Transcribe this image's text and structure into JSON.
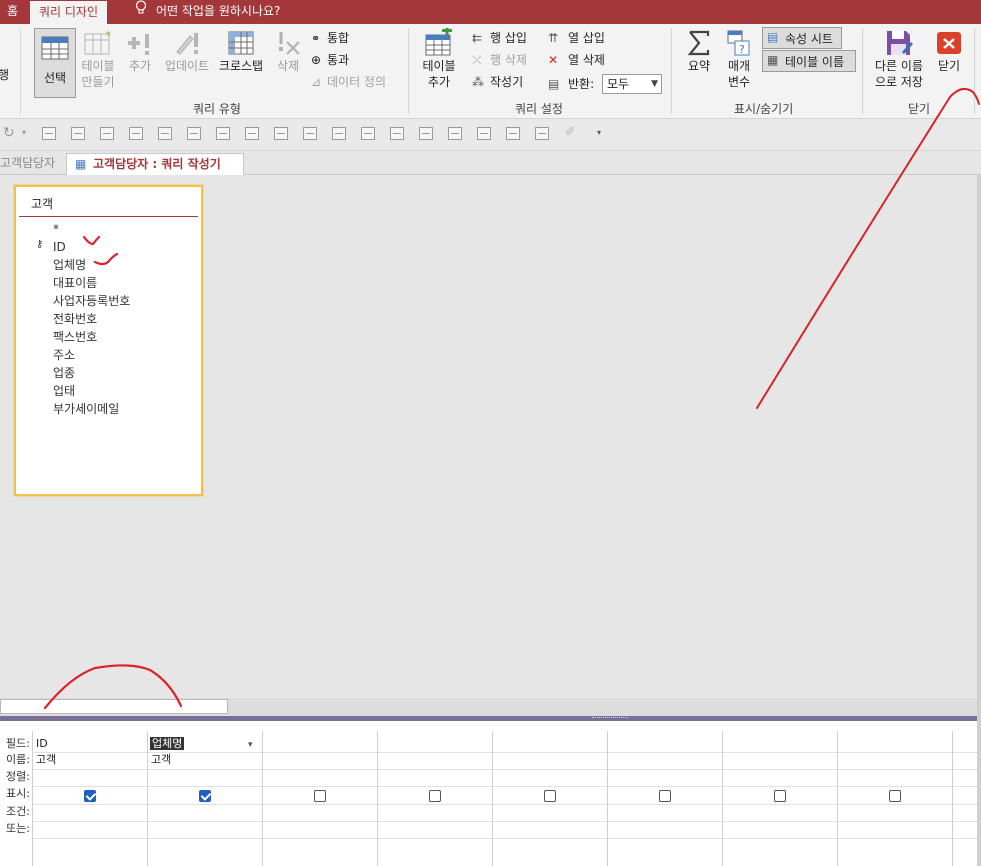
{
  "ribbon_tabs": {
    "home": "홈",
    "query_design": "쿼리 디자인",
    "tell_me": "어떤 작업을 원하시나요?"
  },
  "ribbon": {
    "run_partial": "행",
    "select": "선택",
    "make_table": [
      "테이블",
      "만들기"
    ],
    "append": "추가",
    "update": "업데이트",
    "crosstab": "크로스탭",
    "delete": "삭제",
    "union": "통합",
    "pass_through": "통과",
    "data_definition": "데이터 정의",
    "query_type_label": "쿼리 유형",
    "show_table": [
      "테이블",
      "추가"
    ],
    "insert_rows": "행 삽입",
    "delete_rows": "행 삭제",
    "builder": "작성기",
    "insert_columns": "열 삽입",
    "delete_columns": "열 삭제",
    "return_label": "반환:",
    "return_value": "모두",
    "query_setup_label": "쿼리 설정",
    "totals": "요약",
    "parameters": [
      "매개",
      "변수"
    ],
    "property_sheet": "속성 시트",
    "table_names": "테이블 이름",
    "show_hide_label": "표시/숨기기",
    "save_as": [
      "다른 이름",
      "으로 저장"
    ],
    "close": "닫기",
    "close_group_label": "닫기"
  },
  "doc_tabs": {
    "inactive": "고객담당자",
    "active": "고객담당자 : 쿼리 작성기"
  },
  "table": {
    "name": "고객",
    "fields": [
      "*",
      "ID",
      "업체명",
      "대표이름",
      "사업자등록번호",
      "전화번호",
      "팩스번호",
      "주소",
      "업종",
      "업태",
      "부가세이메일"
    ]
  },
  "grid": {
    "row_labels": [
      "필드:",
      "이름:",
      "정렬:",
      "표시:",
      "조건:",
      "또는:"
    ],
    "columns": [
      {
        "field": "ID",
        "table": "고객",
        "show": true
      },
      {
        "field": "업체명",
        "table": "고객",
        "show": true
      },
      {
        "field": "",
        "table": "",
        "show": false
      },
      {
        "field": "",
        "table": "",
        "show": false
      },
      {
        "field": "",
        "table": "",
        "show": false
      },
      {
        "field": "",
        "table": "",
        "show": false
      },
      {
        "field": "",
        "table": "",
        "show": false
      },
      {
        "field": "",
        "table": "",
        "show": false
      }
    ]
  },
  "colors": {
    "accent": "#a4373a",
    "ink": "#d8232a",
    "checkbox": "#1f5fbf",
    "table_border": "#f2c14a"
  }
}
